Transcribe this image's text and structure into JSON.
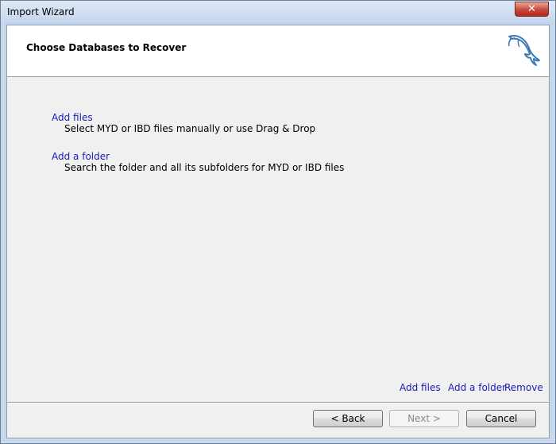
{
  "window": {
    "title": "Import Wizard",
    "close_glyph": "✕"
  },
  "header": {
    "title": "Choose Databases to Recover",
    "logo_icon": "dolphin-logo-icon"
  },
  "options": [
    {
      "label": "Add files",
      "description": "Select MYD or IBD files manually or use Drag & Drop"
    },
    {
      "label": "Add a folder",
      "description": "Search the folder and all its subfolders for MYD or IBD files"
    }
  ],
  "bottom_links": {
    "add_files": "Add files",
    "add_folder": "Add a folder",
    "remove": "Remove"
  },
  "buttons": {
    "back": "< Back",
    "next": "Next >",
    "cancel": "Cancel"
  },
  "colors": {
    "link": "#1b1bb8",
    "logo": "#3a7ab0"
  }
}
